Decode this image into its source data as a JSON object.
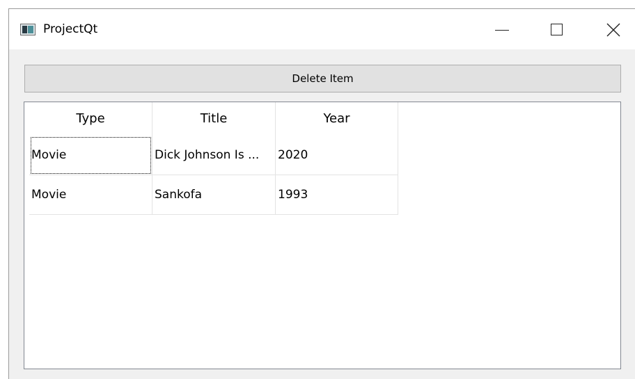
{
  "window": {
    "title": "ProjectQt",
    "app_icon": "qt-window-icon",
    "controls": {
      "minimize_icon": "minimize-icon",
      "maximize_icon": "maximize-icon",
      "close_icon": "close-icon"
    }
  },
  "toolbar": {
    "delete_label": "Delete Item"
  },
  "table": {
    "headers": [
      "Type",
      "Title",
      "Year"
    ],
    "rows": [
      [
        "Movie",
        "Dick Johnson Is ...",
        "2020"
      ],
      [
        "Movie",
        "Sankofa",
        "1993"
      ]
    ],
    "focused_cell": "rows.0.0"
  },
  "colors": {
    "window_bg": "#f0f0f0",
    "button_bg": "#e1e1e1",
    "button_border": "#adadad",
    "table_border": "#828790",
    "grid_line": "#e3e3e3"
  }
}
